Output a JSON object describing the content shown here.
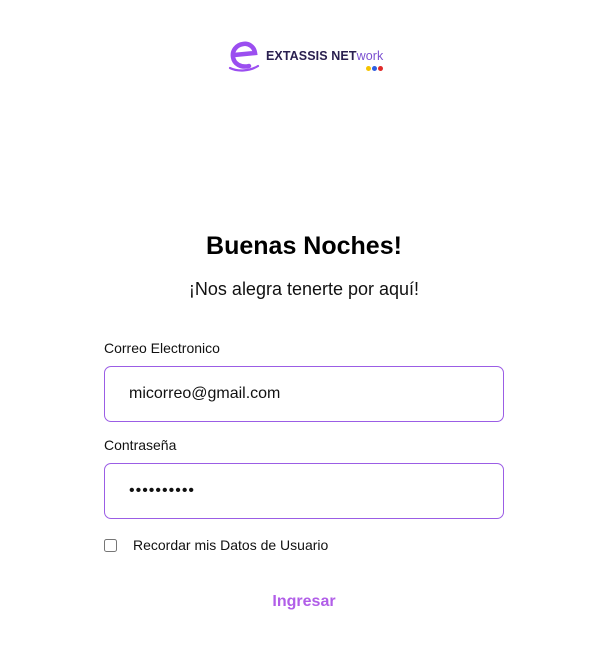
{
  "brand": {
    "name_main": "EXTASSIS NET",
    "name_accent": "work",
    "colors": {
      "mark": "#9b4ef0",
      "text": "#2a2050",
      "accent": "#7a4fd0",
      "dot_yellow": "#f5c400",
      "dot_blue": "#2f5fe0",
      "dot_red": "#e02a2a"
    }
  },
  "login": {
    "greeting": "Buenas Noches!",
    "subtitle": "¡Nos alegra tenerte por aquí!",
    "email": {
      "label": "Correo Electronico",
      "value": "micorreo@gmail.com"
    },
    "password": {
      "label": "Contraseña",
      "value": "••••••••••"
    },
    "remember": {
      "label": "Recordar mis Datos de Usuario",
      "checked": false
    },
    "submit_label": "Ingresar"
  },
  "theme": {
    "input_border": "#9b5de5",
    "button_text": "#b15ee8"
  }
}
